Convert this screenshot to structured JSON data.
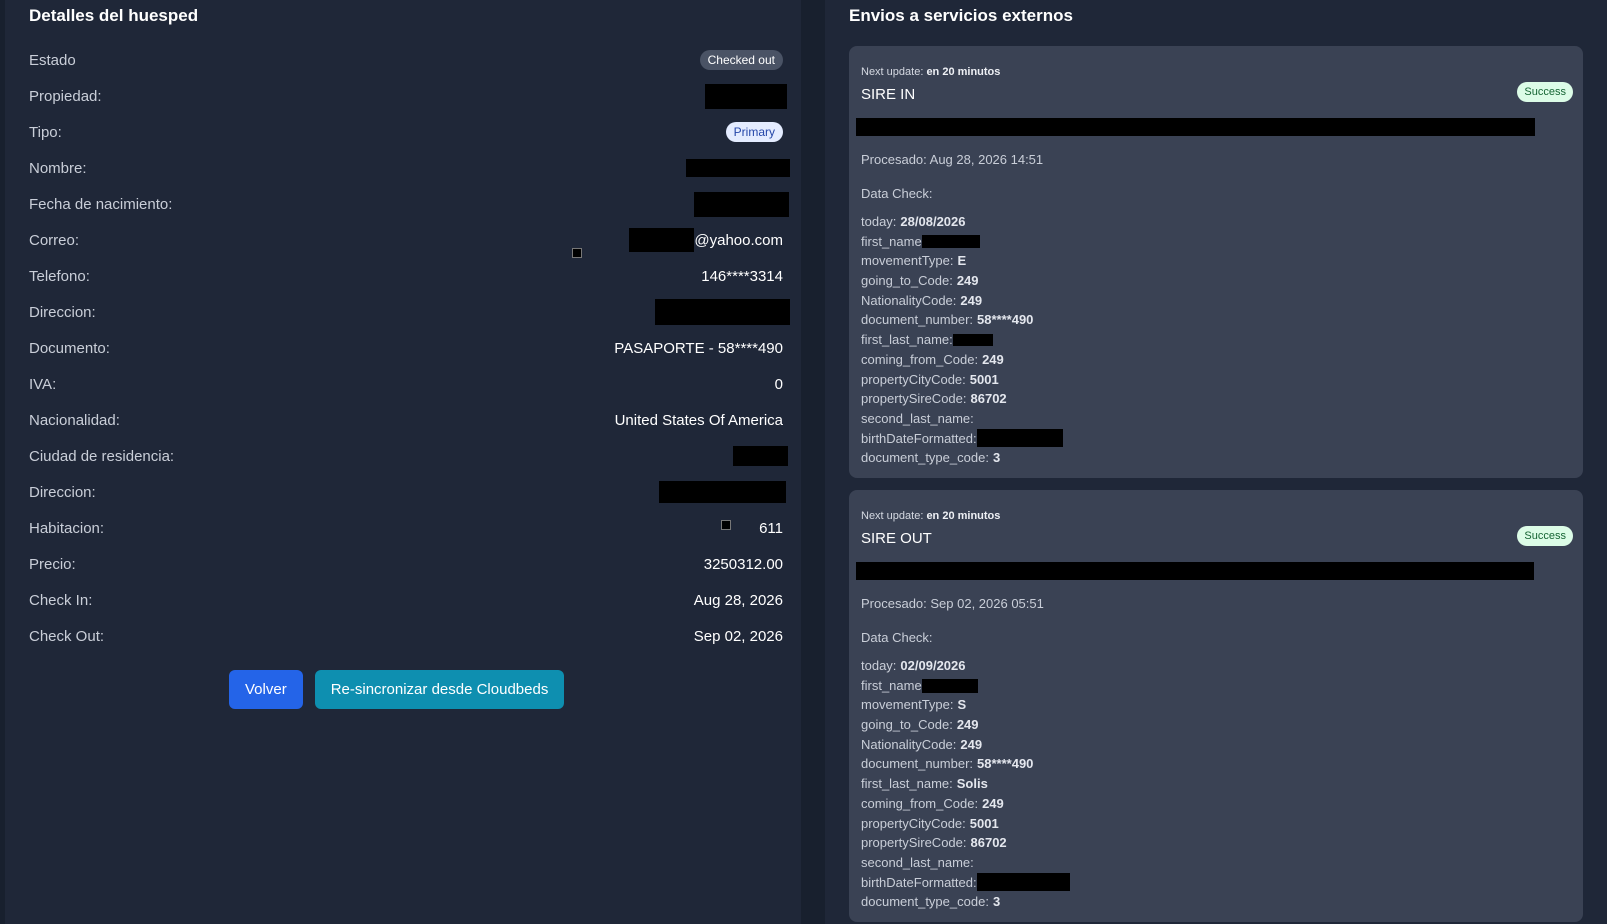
{
  "guest": {
    "title": "Detalles del huesped",
    "rows": [
      {
        "label": "Estado",
        "value": "Checked out"
      },
      {
        "label": "Propiedad:",
        "value": ""
      },
      {
        "label": "Tipo:",
        "value": "Primary"
      },
      {
        "label": "Nombre:",
        "value": ""
      },
      {
        "label": "Fecha de nacimiento:",
        "value": ""
      },
      {
        "label": "Correo:",
        "value": "@yahoo.com"
      },
      {
        "label": "Telefono:",
        "value": "146****3314"
      },
      {
        "label": "Direccion:",
        "value": ""
      },
      {
        "label": "Documento:",
        "value": "PASAPORTE - 58****490"
      },
      {
        "label": "IVA:",
        "value": "0"
      },
      {
        "label": "Nacionalidad:",
        "value": "United States Of America"
      },
      {
        "label": "Ciudad de residencia:",
        "value": ""
      },
      {
        "label": "Direccion:",
        "value": ""
      },
      {
        "label": "Habitacion:",
        "value": "611"
      },
      {
        "label": "Precio:",
        "value": "3250312.00"
      },
      {
        "label": "Check In:",
        "value": "Aug 28, 2026"
      },
      {
        "label": "Check Out:",
        "value": "Sep 02, 2026"
      }
    ],
    "back_button": "Volver",
    "resync_button": "Re-sincronizar desde Cloudbeds"
  },
  "external": {
    "title": "Envios a servicios externos",
    "cards": [
      {
        "next_update_label": "Next update:",
        "next_update_value": "en 20 minutos",
        "name": "SIRE IN",
        "status": "Success",
        "processed": "Procesado: Aug 28, 2026 14:51",
        "data_check_label": "Data Check:",
        "items": [
          {
            "key": "today:",
            "value": "28/08/2026"
          },
          {
            "key": "first_name",
            "value": ""
          },
          {
            "key": "movementType:",
            "value": "E"
          },
          {
            "key": "going_to_Code:",
            "value": "249"
          },
          {
            "key": "NationalityCode:",
            "value": "249"
          },
          {
            "key": "document_number:",
            "value": "58****490"
          },
          {
            "key": "first_last_name:",
            "value": ""
          },
          {
            "key": "coming_from_Code:",
            "value": "249"
          },
          {
            "key": "propertyCityCode:",
            "value": "5001"
          },
          {
            "key": "propertySireCode:",
            "value": "86702"
          },
          {
            "key": "second_last_name:",
            "value": ""
          },
          {
            "key": "birthDateFormatted:",
            "value": ""
          },
          {
            "key": "document_type_code:",
            "value": "3"
          }
        ]
      },
      {
        "next_update_label": "Next update:",
        "next_update_value": "en 20 minutos",
        "name": "SIRE OUT",
        "status": "Success",
        "processed": "Procesado: Sep 02, 2026 05:51",
        "data_check_label": "Data Check:",
        "items": [
          {
            "key": "today:",
            "value": "02/09/2026"
          },
          {
            "key": "first_name",
            "value": ""
          },
          {
            "key": "movementType:",
            "value": "S"
          },
          {
            "key": "going_to_Code:",
            "value": "249"
          },
          {
            "key": "NationalityCode:",
            "value": "249"
          },
          {
            "key": "document_number:",
            "value": "58****490"
          },
          {
            "key": "first_last_name:",
            "value": "Solis"
          },
          {
            "key": "coming_from_Code:",
            "value": "249"
          },
          {
            "key": "propertyCityCode:",
            "value": "5001"
          },
          {
            "key": "propertySireCode:",
            "value": "86702"
          },
          {
            "key": "second_last_name:",
            "value": ""
          },
          {
            "key": "birthDateFormatted:",
            "value": ""
          },
          {
            "key": "document_type_code:",
            "value": "3"
          }
        ]
      }
    ]
  }
}
